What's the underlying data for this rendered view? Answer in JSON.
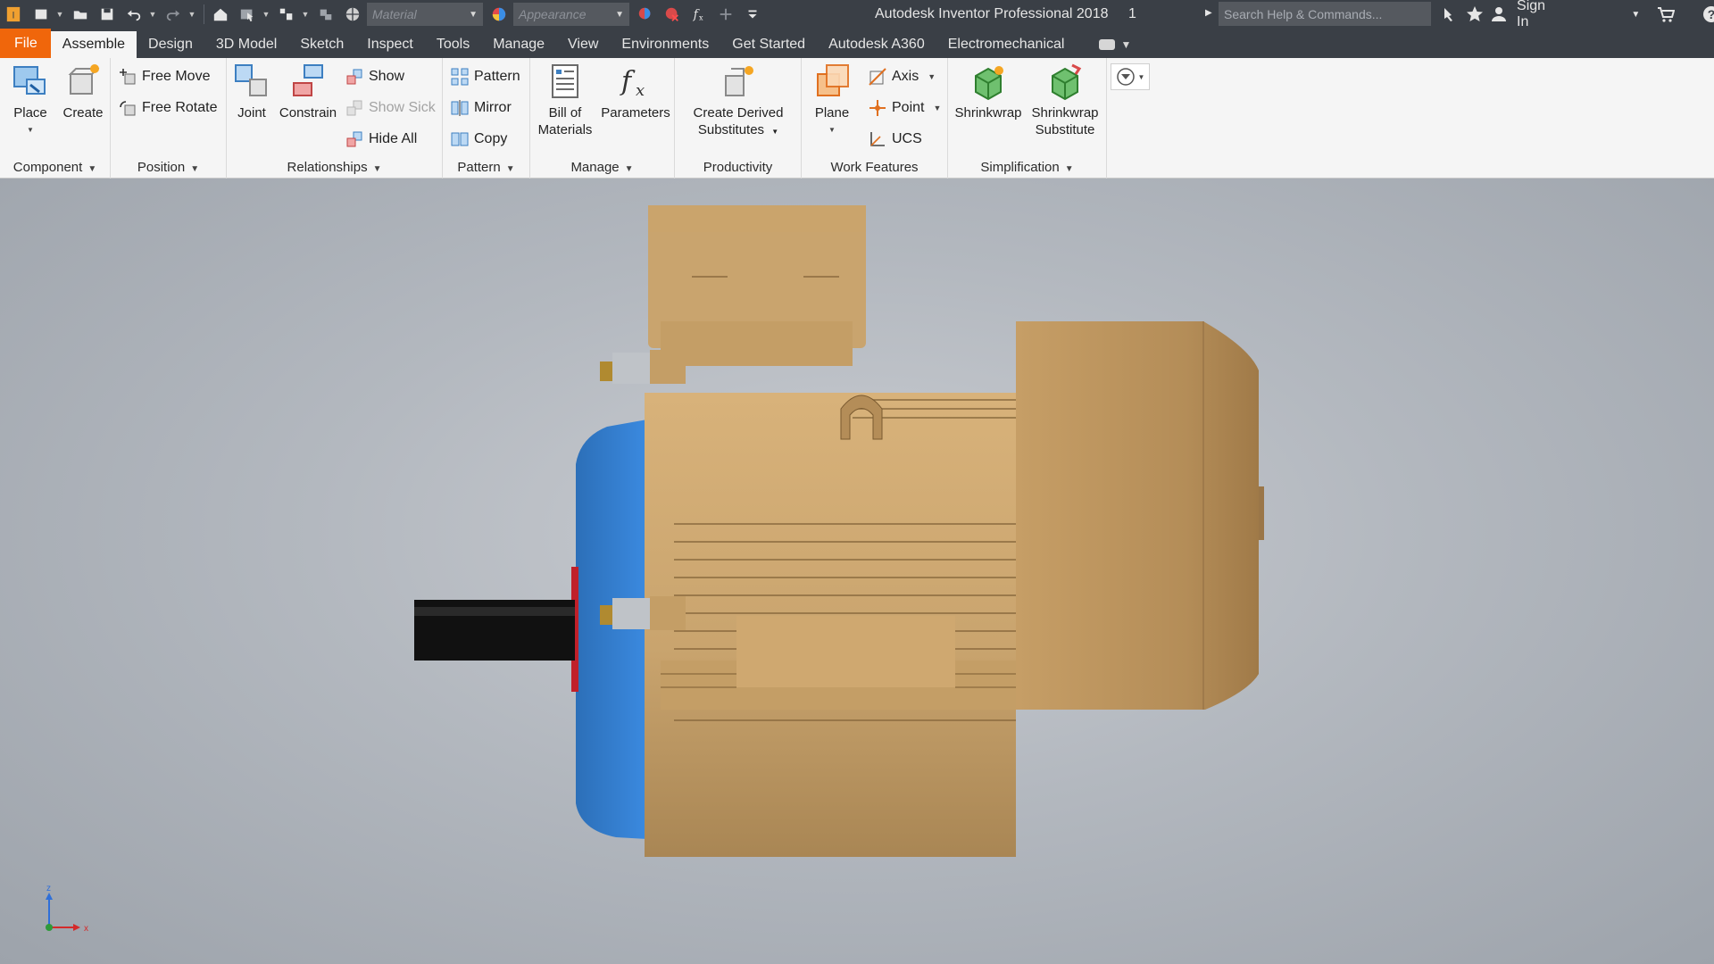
{
  "titlebar": {
    "app_title": "Autodesk Inventor Professional 2018",
    "document": "1",
    "material_placeholder": "Material",
    "appearance_placeholder": "Appearance",
    "search_placeholder": "Search Help & Commands...",
    "sign_in": "Sign In",
    "help": "?"
  },
  "tabs": {
    "file": "File",
    "items": [
      "Assemble",
      "Design",
      "3D Model",
      "Sketch",
      "Inspect",
      "Tools",
      "Manage",
      "View",
      "Environments",
      "Get Started",
      "Autodesk A360",
      "Electromechanical"
    ],
    "active": "Assemble"
  },
  "ribbon": {
    "component": {
      "title": "Component",
      "place": "Place",
      "create": "Create"
    },
    "position": {
      "title": "Position",
      "free_move": "Free Move",
      "free_rotate": "Free Rotate"
    },
    "relationships": {
      "title": "Relationships",
      "joint": "Joint",
      "constrain": "Constrain",
      "show": "Show",
      "show_sick": "Show Sick",
      "hide_all": "Hide All"
    },
    "pattern": {
      "title": "Pattern",
      "pattern": "Pattern",
      "mirror": "Mirror",
      "copy": "Copy"
    },
    "manage": {
      "title": "Manage",
      "bom_line1": "Bill of",
      "bom_line2": "Materials",
      "parameters": "Parameters"
    },
    "productivity": {
      "title": "Productivity",
      "line1": "Create Derived",
      "line2": "Substitutes"
    },
    "work_features": {
      "title": "Work Features",
      "plane": "Plane",
      "axis": "Axis",
      "point": "Point",
      "ucs": "UCS"
    },
    "simplification": {
      "title": "Simplification",
      "shrinkwrap": "Shrinkwrap",
      "sub_line1": "Shrinkwrap",
      "sub_line2": "Substitute"
    }
  },
  "viewport": {
    "model": "electric motor assembly",
    "colors": {
      "body": "#c9a46e",
      "flange": "#2f7fd0",
      "shaft": "#111111",
      "background": "#b3b8bf"
    },
    "triad": {
      "z": "z",
      "x": "x"
    }
  }
}
